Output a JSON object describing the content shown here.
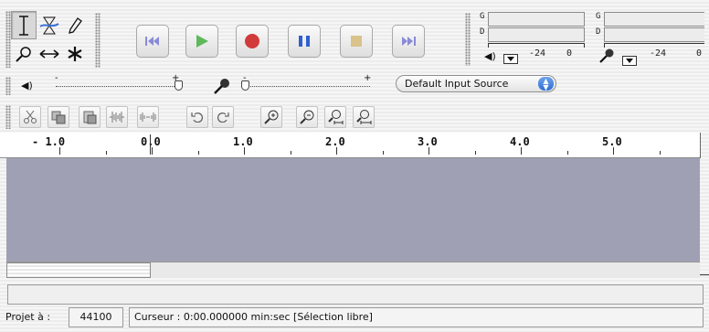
{
  "tools": {
    "icons": [
      "selection-tool-icon",
      "envelope-tool-icon",
      "draw-tool-icon",
      "zoom-tool-icon",
      "timeshift-tool-icon",
      "multi-tool-icon"
    ],
    "selected": "selection-tool-icon"
  },
  "transport": {
    "buttons": [
      "skip-to-start-button",
      "play-button",
      "record-button",
      "pause-button",
      "stop-button",
      "skip-to-end-button"
    ],
    "colors": {
      "play": "#5fb85c",
      "record": "#d23b3b",
      "pause": "#2f5fd0",
      "stop": "#d9c38a",
      "skip": "#8a8ad8"
    }
  },
  "meters": {
    "play": {
      "left_label": "G",
      "right_label": "D",
      "scale_min": "-24",
      "scale_max": "0"
    },
    "record": {
      "left_label": "G",
      "right_label": "D",
      "scale_min": "-24",
      "scale_max": "0"
    }
  },
  "mixer": {
    "input_source": "Default Input Source",
    "output_volume_fraction": 1.0,
    "input_volume_fraction": 0.0
  },
  "ruler": {
    "labels": [
      "- 1.0",
      "0.0",
      "1.0",
      "2.0",
      "3.0",
      "4.0",
      "5.0"
    ]
  },
  "status": {
    "rate_label": "Projet à :",
    "rate_value": "44100",
    "cursor_text": "Curseur : 0:00.000000 min:sec  [Sélection libre]"
  }
}
